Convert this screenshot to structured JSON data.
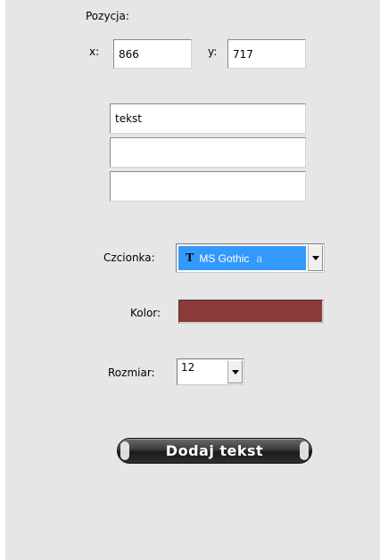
{
  "position": {
    "title": "Pozycja:",
    "x_label": "x:",
    "x_value": "866",
    "y_label": "y:",
    "y_value": "717"
  },
  "text_lines": [
    "tekst",
    "",
    ""
  ],
  "font": {
    "label": "Czcionka:",
    "selected": "MS Gothic",
    "icon_glyph": "T",
    "trailing_glyph": "a"
  },
  "color": {
    "label": "Kolor:",
    "value": "#8b3a3a"
  },
  "size": {
    "label": "Rozmiar:",
    "selected": "12"
  },
  "actions": {
    "add_text_label": "Dodaj tekst"
  }
}
